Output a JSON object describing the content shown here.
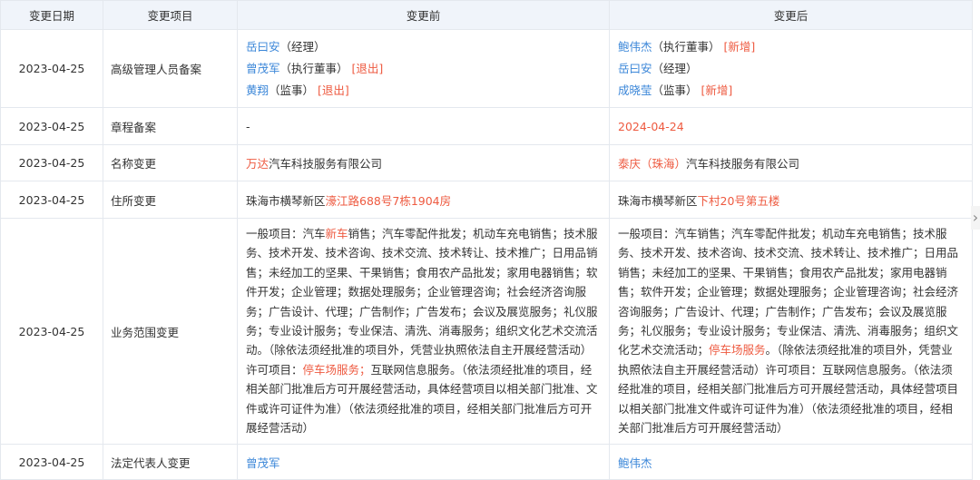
{
  "headers": {
    "date": "变更日期",
    "item": "变更项目",
    "before": "变更前",
    "after": "变更后"
  },
  "rows": [
    {
      "date": "2023-04-25",
      "item": "高级管理人员备案",
      "before": [
        {
          "name": "岳曰安",
          "role": "（经理）",
          "tag": ""
        },
        {
          "name": "曾茂军",
          "role": "（执行董事）",
          "tag": "[退出]"
        },
        {
          "name": "黄翔",
          "role": "（监事）",
          "tag": "[退出]"
        }
      ],
      "after": [
        {
          "name": "鲍伟杰",
          "role": "（执行董事）",
          "tag": "[新增]"
        },
        {
          "name": "岳曰安",
          "role": "（经理）",
          "tag": ""
        },
        {
          "name": "成晓莹",
          "role": "（监事）",
          "tag": "[新增]"
        }
      ]
    },
    {
      "date": "2023-04-25",
      "item": "章程备案",
      "before": "-",
      "after": "2024-04-24"
    },
    {
      "date": "2023-04-25",
      "item": "名称变更",
      "before_highlight": "万达",
      "before_rest": "汽车科技服务有限公司",
      "after_highlight": "泰庆（珠海）",
      "after_rest": "汽车科技服务有限公司"
    },
    {
      "date": "2023-04-25",
      "item": "住所变更",
      "before_plain": "珠海市横琴新区",
      "before_highlight": "濠江路688号7栋1904房",
      "after_plain": "珠海市横琴新区",
      "after_highlight": "下村20号第五楼"
    },
    {
      "date": "2023-04-25",
      "item": "业务范围变更",
      "before_1": "一般项目：汽车",
      "before_2": "新车",
      "before_3": "销售；汽车零配件批发；机动车充电销售；技术服务、技术开发、技术咨询、技术交流、技术转让、技术推广；日用品销售；未经加工的坚果、干果销售；食用农产品批发；家用电器销售；软件开发；企业管理；数据处理服务；企业管理咨询；社会经济咨询服务；广告设计、代理；广告制作；广告发布；会议及展览服务；礼仪服务；专业设计服务；专业保洁、清洗、消毒服务；组织文化艺术交流活动。（除依法须经批准的项目外，凭营业执照依法自主开展经营活动）许可项目：",
      "before_4": "停车场服务；",
      "before_5": "互联网信息服务。（依法须经批准的项目，经相关部门批准后方可开展经营活动，具体经营项目以相关部门批准、文件或许可证件为准）（依法须经批准的项目，经相关部门批准后方可开展经营活动）",
      "after_1": "一般项目：汽车销售；汽车零配件批发；机动车充电销售；技术服务、技术开发、技术咨询、技术交流、技术转让、技术推广；日用品销售；未经加工的坚果、干果销售；食用农产品批发；家用电器销售；软件开发；企业管理；数据处理服务；企业管理咨询；社会经济咨询服务；广告设计、代理；广告制作；广告发布；会议及展览服务；礼仪服务；专业设计服务；专业保洁、清洗、消毒服务；组织文化艺术交流活动；",
      "after_2": "停车场服务",
      "after_3": "。（除依法须经批准的项目外，凭营业执照依法自主开展经营活动）许可项目：互联网信息服务。（依法须经批准的项目，经相关部门批准后方可开展经营活动，具体经营项目以相关部门批准文件或许可证件为准）（依法须经批准的项目，经相关部门批准后方可开展经营活动）"
    },
    {
      "date": "2023-04-25",
      "item": "法定代表人变更",
      "before": "曾茂军",
      "after": "鲍伟杰"
    }
  ],
  "icons": {
    "scroll_right": "chevron-right-icon"
  },
  "colors": {
    "header_bg": "#f0f4fa",
    "link": "#3a86d8",
    "highlight": "#ee5a40",
    "border": "#e4e8ee"
  }
}
